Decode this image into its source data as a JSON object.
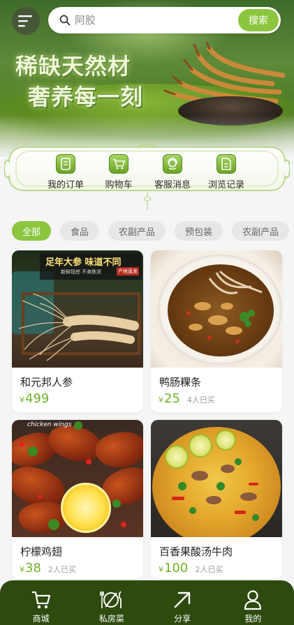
{
  "hero": {
    "title": "稀缺天然材",
    "subtitle": "奢养每一刻"
  },
  "search": {
    "placeholder": "阿胶",
    "button_label": "搜索",
    "icon": "search-icon"
  },
  "quick_menu": [
    {
      "label": "我的订单",
      "icon": "order-icon"
    },
    {
      "label": "购物车",
      "icon": "cart-icon"
    },
    {
      "label": "客服消息",
      "icon": "service-icon"
    },
    {
      "label": "浏览记录",
      "icon": "history-icon"
    }
  ],
  "tabs": [
    {
      "label": "全部",
      "active": true
    },
    {
      "label": "食品",
      "active": false
    },
    {
      "label": "农副产品",
      "active": false
    },
    {
      "label": "预包装",
      "active": false
    },
    {
      "label": "农副产品",
      "active": false
    }
  ],
  "products": [
    {
      "name": "和元邦人参",
      "currency": "¥",
      "price": "499",
      "sold": "",
      "image_text": {
        "headline": "足年大参 味道不同",
        "sub": "新鲜现挖 不卖陈货",
        "tag": "产地直发"
      }
    },
    {
      "name": "鸭肠粿条",
      "currency": "¥",
      "price": "25",
      "sold": "4人已买"
    },
    {
      "name": "柠檬鸡翅",
      "currency": "¥",
      "price": "38",
      "sold": "2人已买",
      "image_text": {
        "label": "chicken wings"
      }
    },
    {
      "name": "百香果酸汤牛肉",
      "currency": "¥",
      "price": "100",
      "sold": "2人已买"
    }
  ],
  "bottom_nav": [
    {
      "label": "商城",
      "icon": "shop-cart-icon"
    },
    {
      "label": "私房菜",
      "icon": "dining-icon"
    },
    {
      "label": "分享",
      "icon": "share-arrow-icon"
    },
    {
      "label": "我的",
      "icon": "profile-icon"
    }
  ],
  "colors": {
    "accent": "#8cc63f",
    "price": "#6fb12b",
    "nav_bg": "#2e4a0f",
    "tab_inactive_bg": "#e7e8e6"
  }
}
